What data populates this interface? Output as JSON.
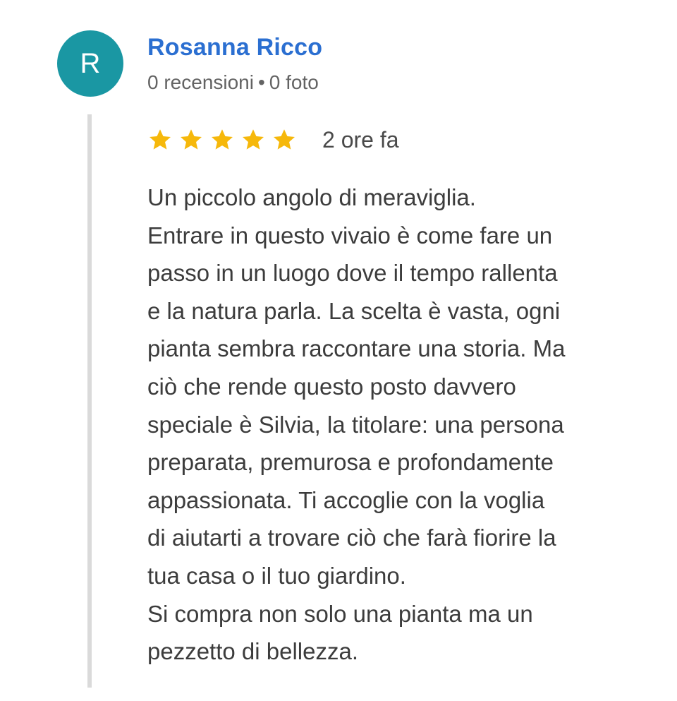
{
  "review": {
    "avatar_initial": "R",
    "avatar_color": "#1a97a3",
    "author_name": "Rosanna Ricco",
    "author_color": "#2b6fd1",
    "reviews_count": "0 recensioni",
    "separator": "•",
    "photos_count": "0 foto",
    "rating": 5,
    "rating_max": 5,
    "star_color": "#f6b80b",
    "time_ago": "2 ore fa",
    "text_lines": [
      "Un piccolo angolo di meraviglia.",
      "Entrare in questo vivaio è come fare un",
      "passo in un luogo dove il tempo rallenta",
      "e la natura parla. La scelta è vasta, ogni",
      "pianta sembra raccontare una storia. Ma",
      "ciò che rende questo posto davvero",
      "speciale è Silvia, la titolare: una persona",
      "preparata, premurosa e profondamente",
      "appassionata. Ti accoglie con la voglia",
      "di aiutarti a trovare ciò che farà fiorire la",
      "tua casa o il tuo giardino.",
      "Si compra non solo una pianta ma un",
      "pezzetto di bellezza."
    ]
  }
}
